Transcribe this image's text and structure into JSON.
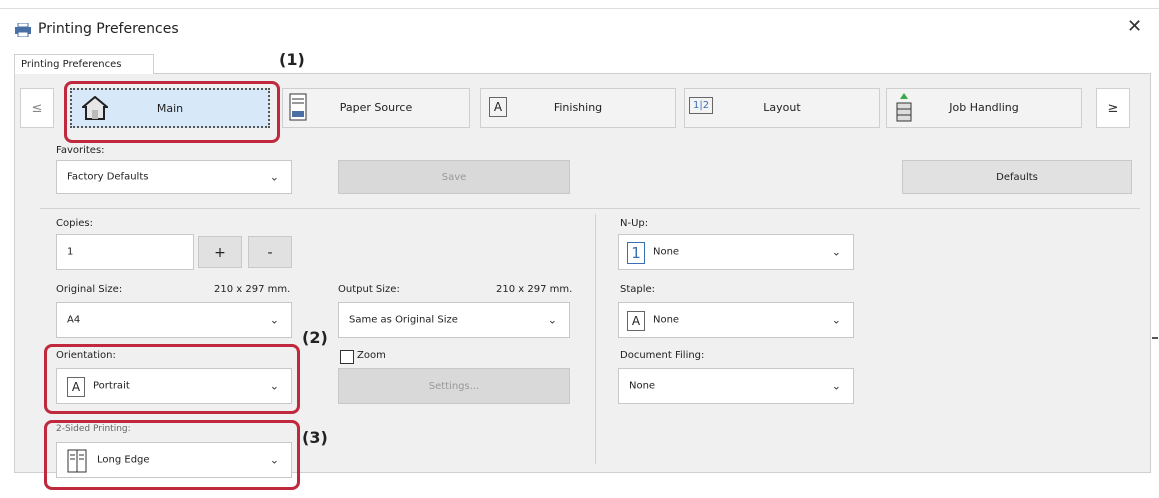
{
  "window": {
    "title": "Printing Preferences"
  },
  "tab": {
    "label": "Printing Preferences"
  },
  "nav": {
    "left_arrow": "≤",
    "right_arrow": "≥",
    "tabs": [
      {
        "label": "Main",
        "icon": "home-icon",
        "active": true
      },
      {
        "label": "Paper Source",
        "icon": "paper-tray-icon"
      },
      {
        "label": "Finishing",
        "icon": "finishing-icon"
      },
      {
        "label": "Layout",
        "icon": "layout-icon"
      },
      {
        "label": "Job Handling",
        "icon": "job-handling-icon"
      }
    ]
  },
  "favorites": {
    "label": "Favorites:",
    "value": "Factory Defaults",
    "save": "Save",
    "defaults": "Defaults"
  },
  "copies": {
    "label": "Copies:",
    "value": "1",
    "plus": "+",
    "minus": "-"
  },
  "original_size": {
    "label": "Original Size:",
    "dims": "210 x 297 mm.",
    "value": "A4"
  },
  "output_size": {
    "label": "Output Size:",
    "dims": "210 x 297 mm.",
    "value": "Same as Original Size"
  },
  "orientation": {
    "label": "Orientation:",
    "value": "Portrait",
    "icon_text": "A"
  },
  "zoom": {
    "label": "Zoom",
    "checked": false,
    "settings": "Settings..."
  },
  "two_sided": {
    "label": "2-Sided Printing:",
    "value": "Long Edge"
  },
  "nup": {
    "label": "N-Up:",
    "value": "None",
    "icon_text": "1"
  },
  "staple": {
    "label": "Staple:",
    "value": "None",
    "icon_text": "A"
  },
  "document_filing": {
    "label": "Document Filing:",
    "value": "None"
  },
  "callouts": {
    "one": "(1)",
    "two": "(2)",
    "three": "(3)"
  },
  "colors": {
    "callout": "#c0283e",
    "active_tab": "#d7e8f9"
  }
}
